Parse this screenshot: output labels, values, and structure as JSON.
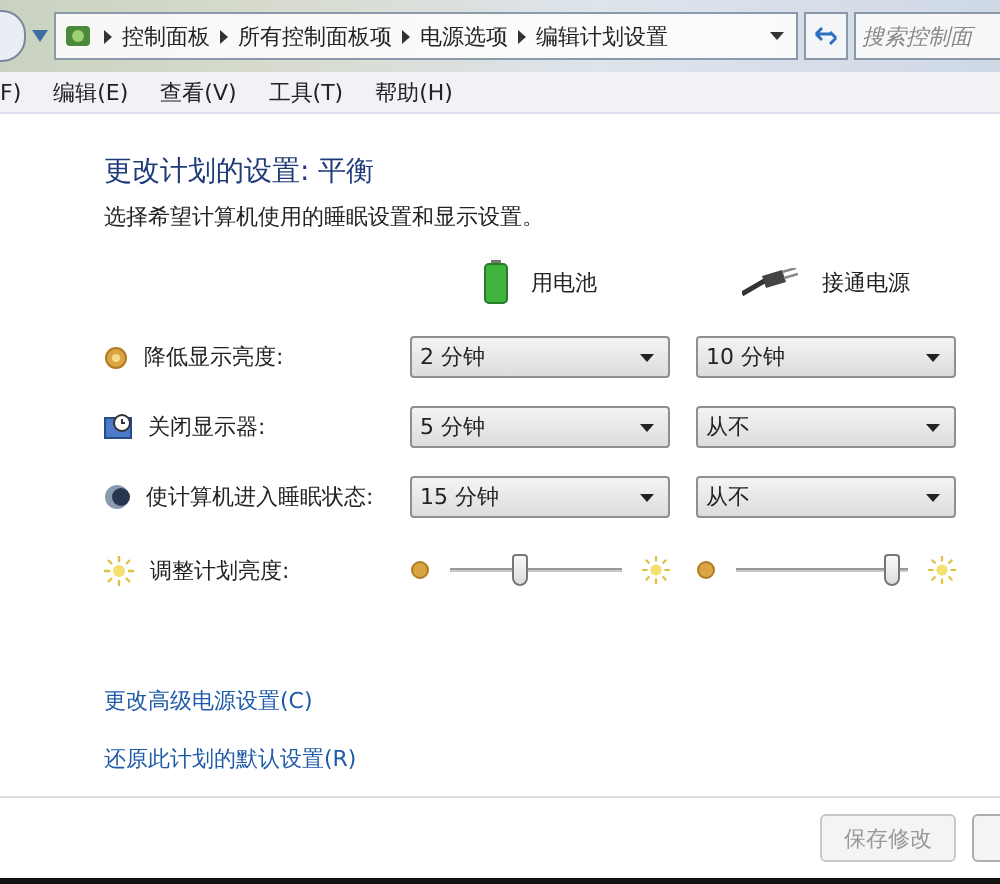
{
  "address_bar": {
    "breadcrumbs": [
      "控制面板",
      "所有控制面板项",
      "电源选项",
      "编辑计划设置"
    ],
    "search": {
      "placeholder": "搜索控制面"
    }
  },
  "menu_bar": [
    "F)",
    "编辑(E)",
    "查看(V)",
    "工具(T)",
    "帮助(H)"
  ],
  "heading": "更改计划的设置: 平衡",
  "description": "选择希望计算机使用的睡眠设置和显示设置。",
  "columns": [
    {
      "kind": "battery",
      "label": "用电池"
    },
    {
      "kind": "plug",
      "label": "接通电源"
    }
  ],
  "settings": [
    {
      "label": "降低显示亮度:",
      "kind": "dropdown",
      "values": [
        "2 分钟",
        "10 分钟"
      ]
    },
    {
      "label": "关闭显示器:",
      "kind": "dropdown",
      "values": [
        "5 分钟",
        "从不"
      ]
    },
    {
      "label": "使计算机进入睡眠状态:",
      "kind": "dropdown",
      "values": [
        "15 分钟",
        "从不"
      ]
    },
    {
      "label": "调整计划亮度:",
      "kind": "slider",
      "sliders": [
        {
          "level": 0.4
        },
        {
          "level": 0.95
        }
      ]
    }
  ],
  "links": [
    "更改高级电源设置(C)",
    "还原此计划的默认设置(R)"
  ],
  "buttons": [
    {
      "label": "保存修改",
      "disabled": true
    }
  ]
}
